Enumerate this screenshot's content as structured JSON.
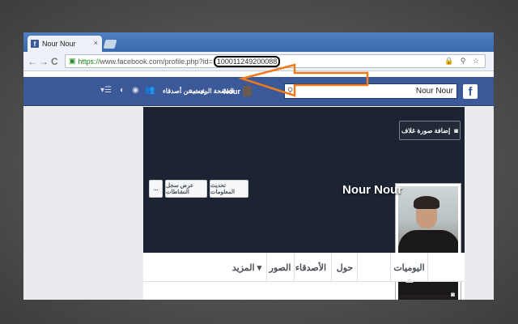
{
  "browser": {
    "tab_title": "Nour Nour",
    "favicon_letter": "f",
    "tab_close": "×",
    "back_glyph": "←",
    "forward_glyph": "→",
    "reload_glyph": "C",
    "url_protocol": "https://",
    "url_rest": "www.facebook.com/profile.php?id=",
    "url_id": "100011249200088",
    "url_icons": "🔒 ⚲ ☆"
  },
  "fb_header": {
    "logo": "f",
    "search_value": "Nour Nour",
    "profile_name": "Nour",
    "home_link": "الصفحة الرئيسية",
    "find_friends_link": "بحث عن أصدقاء",
    "icons": [
      "friend-requests-icon",
      "messages-icon",
      "notifications-icon",
      "privacy-icon",
      "settings-icon"
    ]
  },
  "profile": {
    "name": "Nour Nour",
    "add_cover_label": "إضافة صورة غلاف",
    "update_info_label": "تحديث المعلومات",
    "activity_log_label": "عرض سجل النشاطات",
    "more_label": "..."
  },
  "tabs": [
    {
      "label": "اليوميات"
    },
    {
      "label": "حول"
    },
    {
      "label": "الأصدقاء"
    },
    {
      "label": "الصور"
    },
    {
      "label": "المزيد ▾"
    }
  ],
  "colors": {
    "fb_blue": "#3b5998",
    "cover_bg": "#1c2434",
    "annotation_arrow": "#f07a1a"
  }
}
